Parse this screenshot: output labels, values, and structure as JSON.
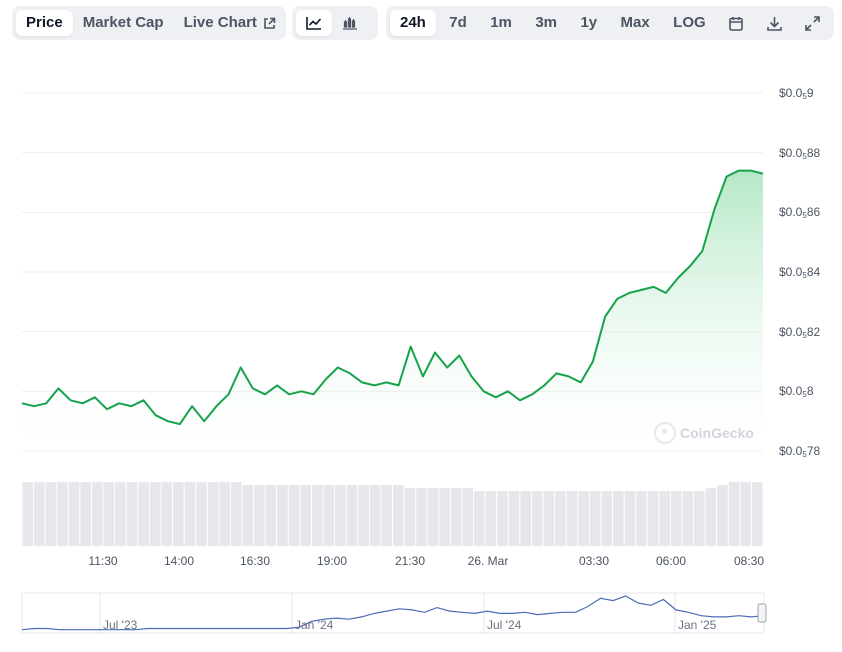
{
  "toolbar": {
    "view_tabs": [
      {
        "label": "Price",
        "active": true
      },
      {
        "label": "Market Cap",
        "active": false
      },
      {
        "label": "Live Chart",
        "active": false,
        "icon": "external-link-icon"
      }
    ],
    "chart_style_icons": [
      "line-chart-icon",
      "candlestick-chart-icon"
    ],
    "range_tabs": [
      {
        "label": "24h",
        "active": true
      },
      {
        "label": "7d",
        "active": false
      },
      {
        "label": "1m",
        "active": false
      },
      {
        "label": "3m",
        "active": false
      },
      {
        "label": "1y",
        "active": false
      },
      {
        "label": "Max",
        "active": false
      },
      {
        "label": "LOG",
        "active": false
      }
    ],
    "action_icons": [
      "calendar-icon",
      "download-icon",
      "fullscreen-icon"
    ]
  },
  "watermark": "CoinGecko",
  "colors": {
    "line": "#16a34a",
    "fill_top": "#9be0b3",
    "volume": "#e5e7eb",
    "navigator": "#4b6cb7",
    "grid": "#eeeeee"
  },
  "chart_data": {
    "type": "area",
    "price_axis": {
      "prefix": "$0.0",
      "subscript": "5",
      "ticks": [
        "9",
        "88",
        "86",
        "84",
        "82",
        "8",
        "78"
      ],
      "tick_values": [
        9e-06,
        8.8e-06,
        8.6e-06,
        8.4e-06,
        8.2e-06,
        8e-06,
        7.8e-06
      ],
      "ylim": [
        7.8e-06,
        9e-06
      ]
    },
    "x_ticks": [
      "11:30",
      "14:00",
      "16:30",
      "19:00",
      "21:30",
      "26. Mar",
      "03:30",
      "06:00",
      "08:30"
    ],
    "series": [
      {
        "values": [
          7.96e-06,
          7.95e-06,
          7.96e-06,
          8.01e-06,
          7.97e-06,
          7.96e-06,
          7.98e-06,
          7.94e-06,
          7.96e-06,
          7.95e-06,
          7.97e-06,
          7.92e-06,
          7.9e-06,
          7.89e-06,
          7.95e-06,
          7.9e-06,
          7.95e-06,
          7.99e-06,
          8.08e-06,
          8.01e-06,
          7.99e-06,
          8.02e-06,
          7.99e-06,
          8e-06,
          7.99e-06,
          8.04e-06,
          8.08e-06,
          8.06e-06,
          8.03e-06,
          8.02e-06,
          8.03e-06,
          8.02e-06,
          8.15e-06,
          8.05e-06,
          8.13e-06,
          8.08e-06,
          8.12e-06,
          8.05e-06,
          8e-06,
          7.98e-06,
          8e-06,
          7.97e-06,
          7.99e-06,
          8.02e-06,
          8.06e-06,
          8.05e-06,
          8.03e-06,
          8.1e-06,
          8.25e-06,
          8.31e-06,
          8.33e-06,
          8.34e-06,
          8.35e-06,
          8.33e-06,
          8.38e-06,
          8.42e-06,
          8.47e-06,
          8.61e-06,
          8.72e-06,
          8.74e-06,
          8.74e-06,
          8.73e-06
        ]
      }
    ],
    "volume": [
      21,
      21,
      21,
      21,
      21,
      21,
      21,
      21,
      21,
      21,
      21,
      21,
      21,
      21,
      21,
      21,
      21,
      21,
      21,
      20,
      20,
      20,
      20,
      20,
      20,
      20,
      20,
      20,
      20,
      20,
      20,
      20,
      20,
      19,
      19,
      19,
      19,
      19,
      19,
      18,
      18,
      18,
      18,
      18,
      18,
      18,
      18,
      18,
      18,
      18,
      18,
      18,
      18,
      18,
      18,
      18,
      18,
      18,
      18,
      19,
      20,
      21,
      21,
      21
    ],
    "navigator": {
      "labels": [
        "Jul '23",
        "Jan '24",
        "Jul '24",
        "Jan '25"
      ],
      "values": [
        2,
        3,
        3,
        2,
        2,
        2,
        2,
        2,
        2,
        2,
        3,
        3,
        3,
        3,
        3,
        3,
        3,
        3,
        3,
        3,
        3,
        3,
        4,
        9,
        11,
        12,
        11,
        13,
        16,
        18,
        20,
        19,
        17,
        21,
        18,
        17,
        16,
        18,
        16,
        16,
        17,
        15,
        16,
        17,
        17,
        22,
        29,
        27,
        31,
        25,
        23,
        28,
        19,
        17,
        14,
        13,
        13,
        14,
        13,
        14
      ]
    }
  }
}
